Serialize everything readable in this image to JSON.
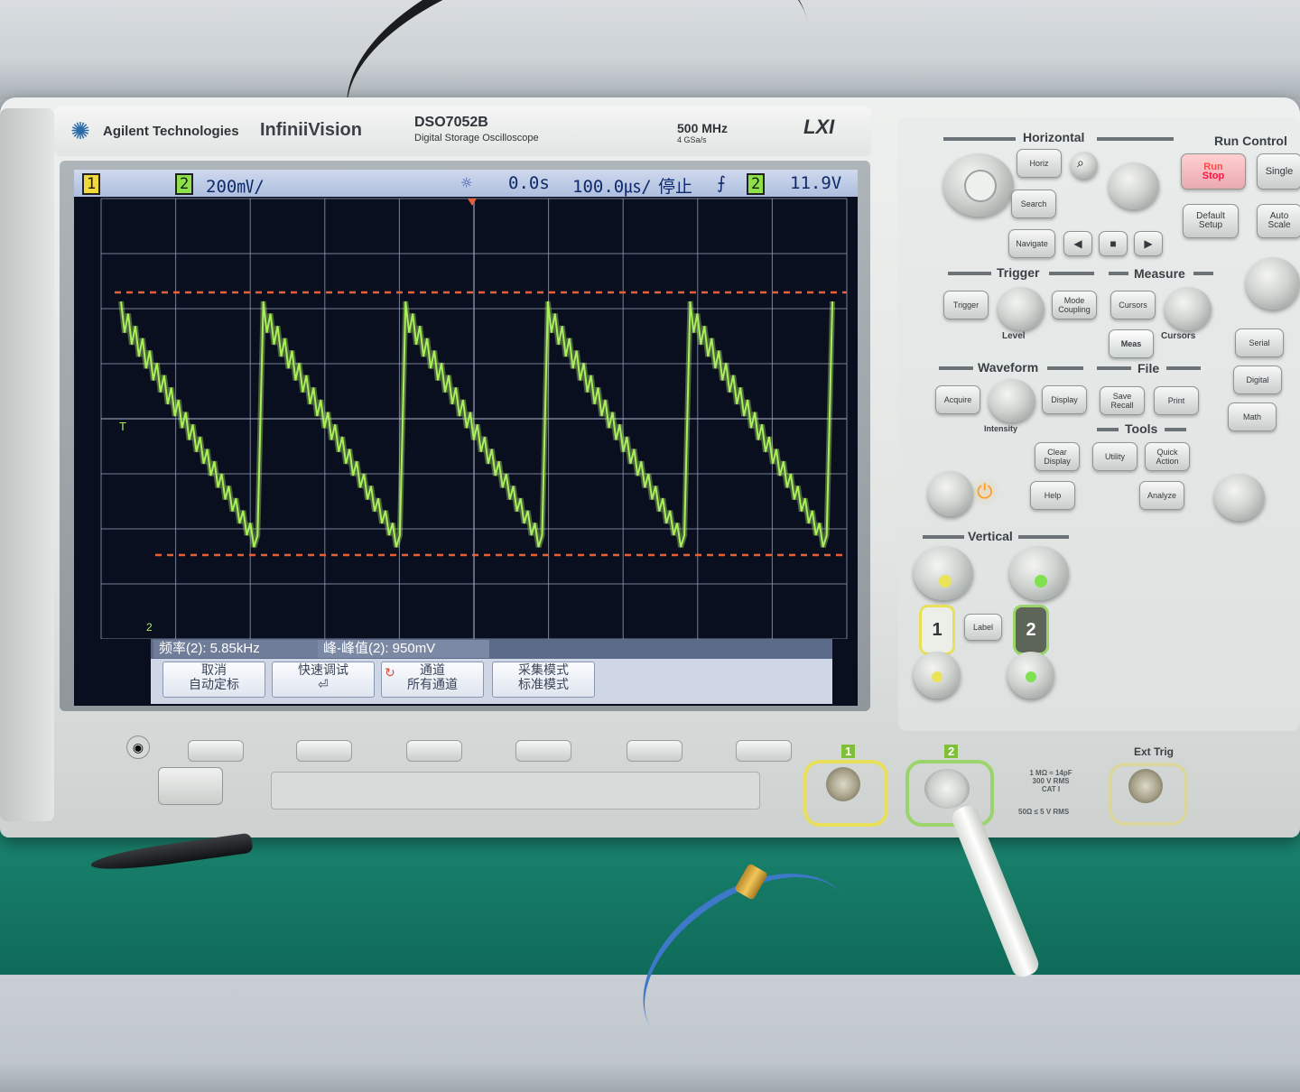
{
  "header": {
    "brand": "Agilent Technologies",
    "product": "InfiniiVision",
    "model": "DSO7052B",
    "model_desc": "Digital Storage Oscilloscope",
    "bandwidth": "500 MHz",
    "sample_rate": "4 GSa/s",
    "lxi": "LXI"
  },
  "status_bar": {
    "ch1": "1",
    "ch2": "2",
    "ch2_scale": "200㎷/",
    "trigger_icon": "sun-icon",
    "delay": "0.0s",
    "timebase": "100.0㎲/",
    "run_state": "停止",
    "edge": "⨍",
    "trig_source": "2",
    "trig_level": "11.9V"
  },
  "screen": {
    "ch2_ground_marker": "2",
    "trigger_marker": "T"
  },
  "measurements": {
    "freq": "频率(2): 5.85kHz",
    "peak_to_peak": "峰-峰值(2): 950mV"
  },
  "softkeys": [
    {
      "line1": "取消",
      "line2": "自动定标"
    },
    {
      "line1": "快速调试",
      "line2": "⏎"
    },
    {
      "line1": "通道",
      "line2": "所有通道"
    },
    {
      "line1": "采集模式",
      "line2": "标准模式"
    }
  ],
  "panel": {
    "horizontal": "Horizontal",
    "run_control": "Run Control",
    "run": "Run",
    "stop": "Stop",
    "single": "Single",
    "horiz": "Horiz",
    "search": "Search",
    "navigate": "Navigate",
    "default_setup": "Default Setup",
    "auto_scale": "Auto Scale",
    "trigger": "Trigger",
    "measure": "Measure",
    "trigger_btn": "Trigger",
    "mode_coupling": "Mode Coupling",
    "level": "Level",
    "cursors_btn": "Cursors",
    "cursors_knob": "Cursors",
    "meas": "Meas",
    "serial": "Serial",
    "digital": "Digital",
    "math": "Math",
    "waveform": "Waveform",
    "file": "File",
    "acquire": "Acquire",
    "display": "Display",
    "intensity": "Intensity",
    "save_recall": "Save Recall",
    "print": "Print",
    "tools": "Tools",
    "clear_display": "Clear Display",
    "utility": "Utility",
    "quick_action": "Quick Action",
    "help": "Help",
    "analyze": "Analyze",
    "vertical": "Vertical",
    "ch1": "1",
    "ch2": "2",
    "label": "Label",
    "input1": "1",
    "input2": "2",
    "ext_trig": "Ext Trig",
    "input_spec": "1 MΩ ≈ 14pF 300 V RMS CAT I",
    "input_spec2": "50Ω ≤ 5 V RMS"
  },
  "colors": {
    "trace": "#a8f05a",
    "cursor": "#e8603a",
    "grid": "#9aa6c0",
    "status_bg": "#b9c7e3",
    "bench": "#157a66"
  },
  "waveform": {
    "type": "sawtooth",
    "frequency_khz": 5.85,
    "timebase_us_per_div": 100.0,
    "v_per_div": 0.2,
    "cycles_on_screen": 5.85
  }
}
